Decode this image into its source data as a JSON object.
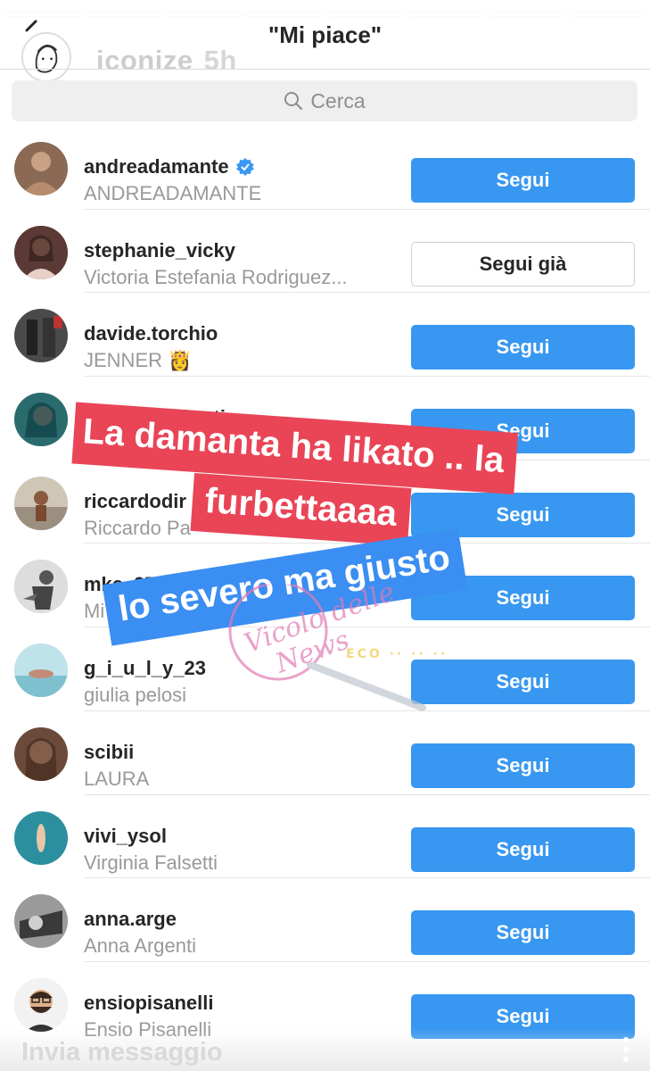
{
  "story": {
    "progress_segments": 8,
    "username": "iconize",
    "time": "5h"
  },
  "header": {
    "title": "\"Mi piace\""
  },
  "search": {
    "placeholder": "Cerca"
  },
  "likers": [
    {
      "username": "andreadamante",
      "fullname": "ANDREADAMANTE",
      "verified": true,
      "button": "Segui",
      "following": false,
      "avatar_color": "#8a6a55"
    },
    {
      "username": "stephanie_vicky",
      "fullname": "Victoria Estefania Rodriguez...",
      "verified": false,
      "button": "Segui già",
      "following": true,
      "avatar_color": "#5b3a36"
    },
    {
      "username": "davide.torchio",
      "fullname": "JENNER",
      "emoji": "👸",
      "verified": false,
      "button": "Segui",
      "following": false,
      "avatar_color": "#3b3b3b"
    },
    {
      "username": "jjessicadalberti",
      "fullname": "",
      "verified": false,
      "button": "Segui",
      "following": false,
      "avatar_color": "#2a6b6e"
    },
    {
      "username": "riccardodir",
      "fullname": "Riccardo Pa",
      "verified": false,
      "button": "Segui",
      "following": false,
      "avatar_color": "#9b8f7f"
    },
    {
      "username": "mkc_97",
      "fullname": "Mi",
      "verified": false,
      "button": "Segui",
      "following": false,
      "avatar_color": "#777777"
    },
    {
      "username": "g_i_u_l_y_23",
      "fullname": "giulia pelosi",
      "verified": false,
      "button": "Segui",
      "following": false,
      "avatar_color": "#a8d4dc"
    },
    {
      "username": "scibii",
      "fullname": "LAURA",
      "verified": false,
      "button": "Segui",
      "following": false,
      "avatar_color": "#6b4a3a"
    },
    {
      "username": "vivi_ysol",
      "fullname": "Virginia Falsetti",
      "verified": false,
      "button": "Segui",
      "following": false,
      "avatar_color": "#2b8fa0"
    },
    {
      "username": "anna.arge",
      "fullname": "Anna Argenti",
      "verified": false,
      "button": "Segui",
      "following": false,
      "avatar_color": "#7a7a7a"
    },
    {
      "username": "ensiopisanelli",
      "fullname": "Ensio Pisanelli",
      "verified": false,
      "button": "Segui",
      "following": false,
      "avatar_color": "#f2f2f2"
    }
  ],
  "overlays": {
    "red_line1": "La damanta ha likato .. la",
    "red_line2": "furbettaaaa",
    "blue_line": "lo severo ma giusto",
    "watermark_line1": "Vicolo delle",
    "watermark_line2": "News"
  },
  "footer": {
    "message_placeholder": "Invia messaggio"
  },
  "colors": {
    "follow_button": "#3897f0",
    "caption_red": "#e94557",
    "caption_blue": "#3b8ef2"
  }
}
